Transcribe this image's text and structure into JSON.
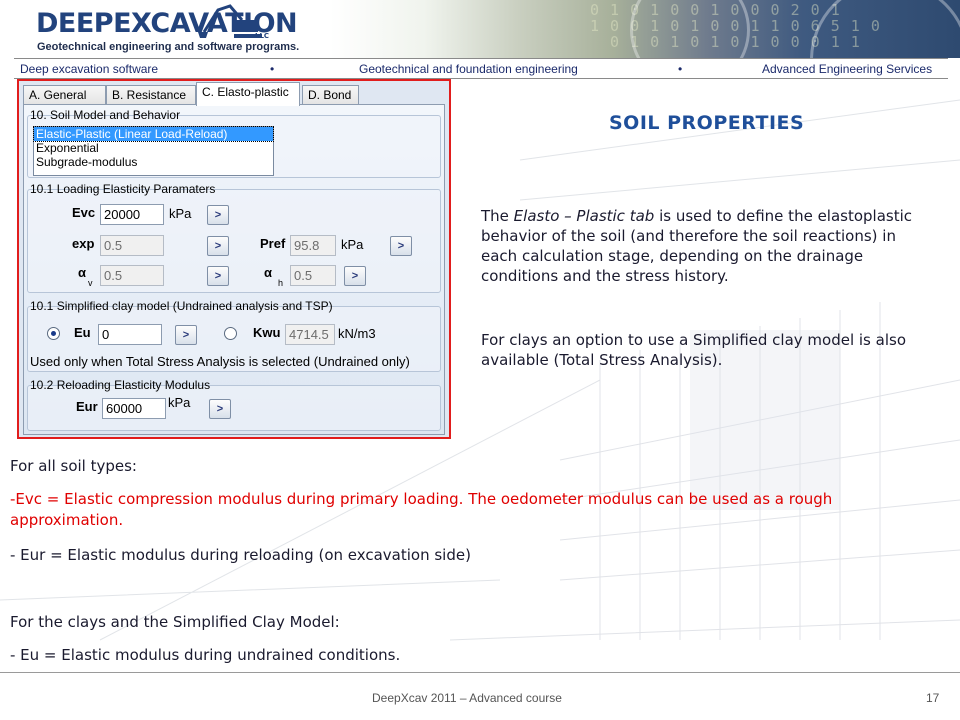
{
  "header": {
    "logo_main": "DEEP",
    "logo_ex": "EXCAVATION",
    "logo_llc": "LLC",
    "tagline": "Geotechnical engineering and software programs."
  },
  "nav": {
    "items": [
      "Deep excavation software",
      "Geotechnical and foundation engineering",
      "Advanced Engineering Services"
    ],
    "separator": "•"
  },
  "dialog": {
    "tabs": [
      "A. General",
      "B. Resistance",
      "C. Elasto-plastic",
      "D. Bond"
    ],
    "active_tab": "C. Elasto-plastic",
    "soil_model": {
      "title": "10. Soil Model and Behavior",
      "options": [
        "Elastic-Plastic (Linear Load-Reload)",
        "Exponential",
        "Subgrade-modulus"
      ],
      "selected": "Elastic-Plastic (Linear Load-Reload)"
    },
    "loading": {
      "title": "10.1 Loading Elasticity Paramaters",
      "evc_label": "Evc",
      "evc_value": "20000",
      "evc_unit": "kPa",
      "exp_label": "exp",
      "exp_value": "0.5",
      "pref_label": "Pref",
      "pref_value": "95.8",
      "pref_unit": "kPa",
      "alpha": "α",
      "alpha_v_sub": "v",
      "alpha_v_value": "0.5",
      "alpha_h_sub": "h",
      "alpha_h_value": "0.5"
    },
    "clay": {
      "title": "10.1 Simplified clay model (Undrained analysis and TSP)",
      "eu_label": "Eu",
      "eu_value": "0",
      "kwu_label": "Kwu",
      "kwu_value": "4714.5",
      "kwu_unit": "kN/m3",
      "note": "Used only when Total Stress Analysis is selected (Undrained only)"
    },
    "reloading": {
      "title": "10.2 Reloading Elasticity Modulus",
      "eur_label": "Eur",
      "eur_value": "60000",
      "eur_unit": "kPa"
    },
    "arrow_glyph": ">"
  },
  "slide": {
    "title": "SOIL PROPERTIES",
    "para1_pre": "The ",
    "para1_em": "Elasto – Plastic tab",
    "para1_post": " is used to define  the elastoplastic behavior of the soil (and therefore the soil reactions) in each calculation stage, depending on the drainage conditions and the stress history.",
    "para2": "For clays an option to use a Simplified clay model is also available (Total Stress Analysis).",
    "all_types": "For all soil types:",
    "evc_def": "-Evc = Elastic compression modulus during primary loading. The oedometer modulus can be used as a rough approximation.",
    "eur_def": "- Eur  = Elastic modulus during reloading (on excavation side)",
    "clays_head": "For the clays and the Simplified Clay Model:",
    "eu_def": "- Eu = Elastic modulus during undrained conditions."
  },
  "footer": {
    "text": "DeepXcav 2011 – Advanced course",
    "page": "17"
  }
}
